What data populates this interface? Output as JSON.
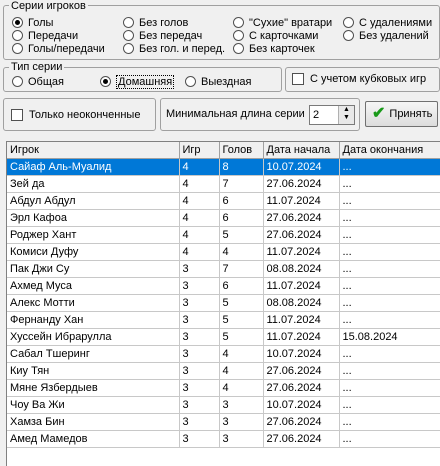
{
  "series_group": {
    "title": "Серии игроков",
    "options": [
      {
        "label": "Голы",
        "selected": true
      },
      {
        "label": "Передачи",
        "selected": false
      },
      {
        "label": "Голы/передачи",
        "selected": false
      },
      {
        "label": "Без голов",
        "selected": false
      },
      {
        "label": "Без передач",
        "selected": false
      },
      {
        "label": "Без гол. и перед.",
        "selected": false
      },
      {
        "label": "\"Сухие\" вратари",
        "selected": false
      },
      {
        "label": "С карточками",
        "selected": false
      },
      {
        "label": "Без карточек",
        "selected": false
      },
      {
        "label": "С удалениями",
        "selected": false
      },
      {
        "label": "Без удалений",
        "selected": false
      }
    ]
  },
  "type_group": {
    "title": "Тип серии",
    "options": [
      {
        "label": "Общая",
        "selected": false
      },
      {
        "label": "Домашняя",
        "selected": true
      },
      {
        "label": "Выездная",
        "selected": false
      }
    ]
  },
  "cup_games_label": "С учетом кубковых игр",
  "unfinished_label": "Только неоконченные",
  "min_length_label": "Минимальная длина серии",
  "min_length_value": "2",
  "accept_button": "Принять",
  "table": {
    "columns": [
      "Игрок",
      "Игр",
      "Голов",
      "Дата начала",
      "Дата окончания"
    ],
    "rows": [
      [
        "Сайаф Аль-Муалид",
        "4",
        "8",
        "10.07.2024",
        "..."
      ],
      [
        "Зей да",
        "4",
        "7",
        "27.06.2024",
        "..."
      ],
      [
        "Абдул Абдул",
        "4",
        "6",
        "11.07.2024",
        "..."
      ],
      [
        "Эрл Кафоа",
        "4",
        "6",
        "27.06.2024",
        "..."
      ],
      [
        "Роджер Хант",
        "4",
        "5",
        "27.06.2024",
        "..."
      ],
      [
        "Комиси Дуфу",
        "4",
        "4",
        "11.07.2024",
        "..."
      ],
      [
        "Пак Джи Су",
        "3",
        "7",
        "08.08.2024",
        "..."
      ],
      [
        "Ахмед Муса",
        "3",
        "6",
        "11.07.2024",
        "..."
      ],
      [
        "Алекс Мотти",
        "3",
        "5",
        "08.08.2024",
        "..."
      ],
      [
        "Фернанду Хан",
        "3",
        "5",
        "11.07.2024",
        "..."
      ],
      [
        "Хуссейн Ибрарулла",
        "3",
        "5",
        "11.07.2024",
        "15.08.2024"
      ],
      [
        "Сабал Тшеринг",
        "3",
        "4",
        "10.07.2024",
        "..."
      ],
      [
        "Киу Тян",
        "3",
        "4",
        "27.06.2024",
        "..."
      ],
      [
        "Мяне Язбердыев",
        "3",
        "4",
        "27.06.2024",
        "..."
      ],
      [
        "Чоу Ва Жи",
        "3",
        "3",
        "10.07.2024",
        "..."
      ],
      [
        "Хамза Бин",
        "3",
        "3",
        "27.06.2024",
        "..."
      ],
      [
        "Амед Мамедов",
        "3",
        "3",
        "27.06.2024",
        "..."
      ]
    ],
    "selected_row": 0
  }
}
